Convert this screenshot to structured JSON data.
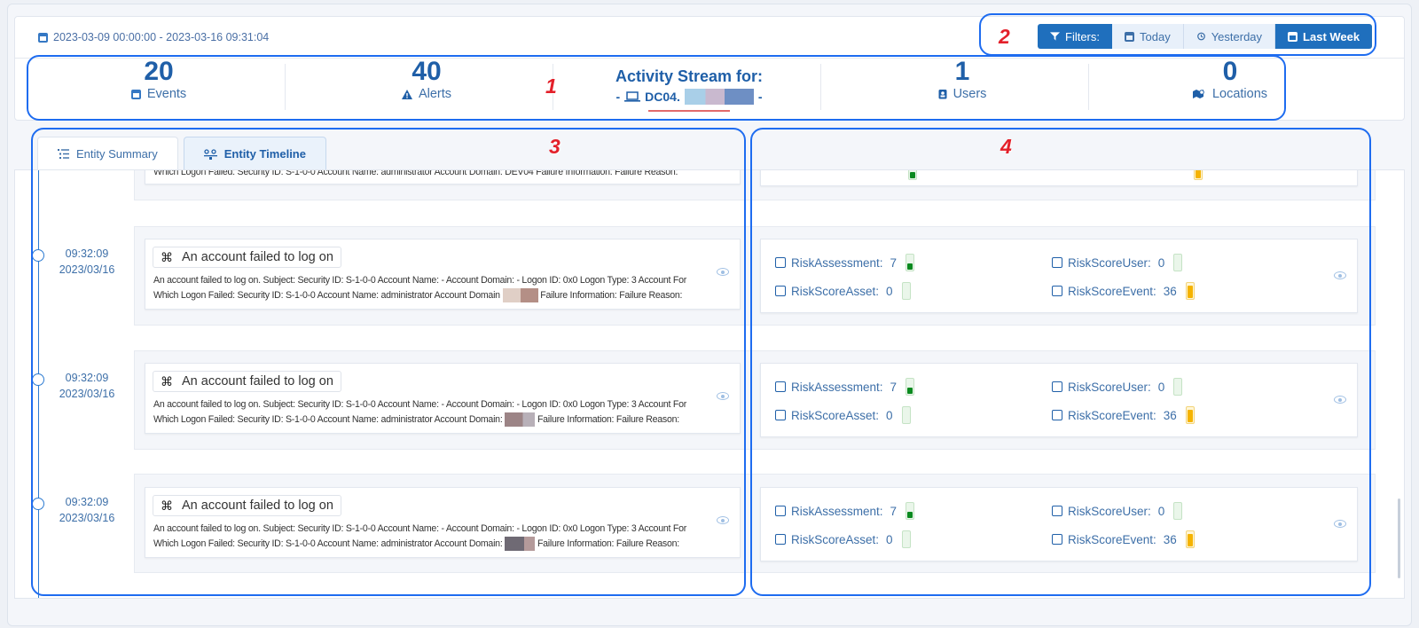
{
  "header": {
    "date_range": "2023-03-09 00:00:00 - 2023-03-16 09:31:04",
    "filters": {
      "filters_label": "Filters:",
      "today_label": "Today",
      "yesterday_label": "Yesterday",
      "last_week_label": "Last Week",
      "active": "Last Week"
    }
  },
  "stats": {
    "events": {
      "value": "20",
      "label": "Events"
    },
    "alerts": {
      "value": "40",
      "label": "Alerts"
    },
    "users": {
      "value": "1",
      "label": "Users"
    },
    "locations": {
      "value": "0",
      "label": "Locations"
    },
    "activity": {
      "title": "Activity Stream for:",
      "host_prefix": "- ",
      "host": "DC04.",
      "host_suffix": "-"
    }
  },
  "markers": [
    "1",
    "2",
    "3",
    "4"
  ],
  "tabs": [
    {
      "label": "Entity Summary",
      "active": false
    },
    {
      "label": "Entity Timeline",
      "active": true
    }
  ],
  "partial_row": {
    "desc": "Which Logon Failed: Security ID: S-1-0-0 Account Name: administrator Account Domain: DEV04 Failure Information: Failure Reason:"
  },
  "events": [
    {
      "time": "09:32:09",
      "date": "2023/03/16",
      "title": "An account failed to log on",
      "desc_line1": "An account failed to log on. Subject: Security ID: S-1-0-0 Account Name: - Account Domain: - Logon ID: 0x0 Logon Type: 3 Account For",
      "desc_line2_a": "Which Logon Failed: Security ID: S-1-0-0 Account Name: administrator Account Domain",
      "desc_line2_b": "Failure Information: Failure Reason:",
      "redact_color": "#c9a79a"
    },
    {
      "time": "09:32:09",
      "date": "2023/03/16",
      "title": "An account failed to log on",
      "desc_line1": "An account failed to log on. Subject: Security ID: S-1-0-0 Account Name: - Account Domain: - Logon ID: 0x0 Logon Type: 3 Account For",
      "desc_line2_a": "Which Logon Failed: Security ID: S-1-0-0 Account Name: administrator Account Domain:",
      "desc_line2_b": "Failure Information: Failure Reason:",
      "redact_color": "#9a8a8f"
    },
    {
      "time": "09:32:09",
      "date": "2023/03/16",
      "title": "An account failed to log on",
      "desc_line1": "An account failed to log on. Subject: Security ID: S-1-0-0 Account Name: - Account Domain: - Logon ID: 0x0 Logon Type: 3 Account For",
      "desc_line2_a": "Which Logon Failed: Security ID: S-1-0-0 Account Name: administrator Account Domain:",
      "desc_line2_b": "Failure Information: Failure Reason:",
      "redact_color": "#7f7a86"
    }
  ],
  "risk": [
    {
      "assessment_label": "RiskAssessment:",
      "assessment": "7",
      "user_label": "RiskScoreUser:",
      "user": "0",
      "asset_label": "RiskScoreAsset:",
      "asset": "0",
      "event_label": "RiskScoreEvent:",
      "event": "36"
    },
    {
      "assessment_label": "RiskAssessment:",
      "assessment": "7",
      "user_label": "RiskScoreUser:",
      "user": "0",
      "asset_label": "RiskScoreAsset:",
      "asset": "0",
      "event_label": "RiskScoreEvent:",
      "event": "36"
    },
    {
      "assessment_label": "RiskAssessment:",
      "assessment": "7",
      "user_label": "RiskScoreUser:",
      "user": "0",
      "asset_label": "RiskScoreAsset:",
      "asset": "0",
      "event_label": "RiskScoreEvent:",
      "event": "36"
    }
  ],
  "colors": {
    "primary": "#1f6fbd",
    "accent_text": "#3d6fa8",
    "marker": "#e3202a",
    "annotation": "#1e6cf0"
  }
}
